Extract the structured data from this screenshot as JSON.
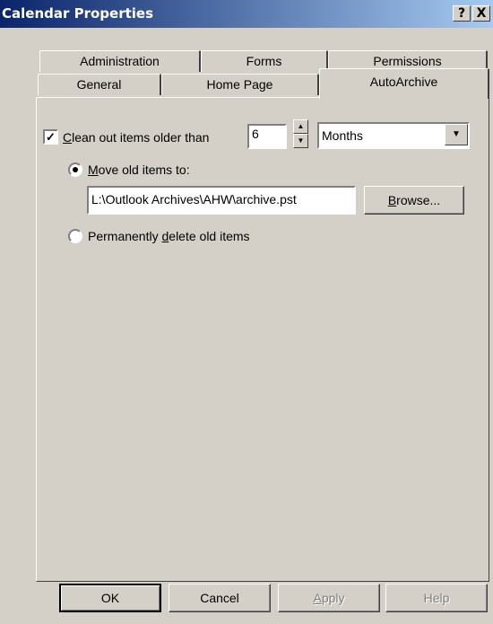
{
  "window": {
    "title": "Calendar Properties",
    "help_label": "?",
    "close_label": "X"
  },
  "tabs": {
    "row1": [
      "Administration",
      "Forms",
      "Permissions"
    ],
    "row2": [
      "General",
      "Home Page",
      "AutoArchive"
    ],
    "selected": "AutoArchive"
  },
  "autoarchive": {
    "clean_checked": true,
    "clean_label": "Clean out items older than",
    "age_value": "6",
    "unit_value": "Months",
    "move_label": "Move old items to:",
    "move_selected": true,
    "path_value": "L:\\Outlook Archives\\AHW\\archive.pst",
    "browse_label": "Browse...",
    "delete_label": "Permanently delete old items",
    "delete_selected": false
  },
  "footer": {
    "ok_label": "OK",
    "cancel_label": "Cancel",
    "apply_label": "Apply",
    "help_label": "Help"
  },
  "icons": {
    "check": "✓",
    "spin_up": "▲",
    "spin_down": "▼",
    "dropdown": "▼"
  }
}
